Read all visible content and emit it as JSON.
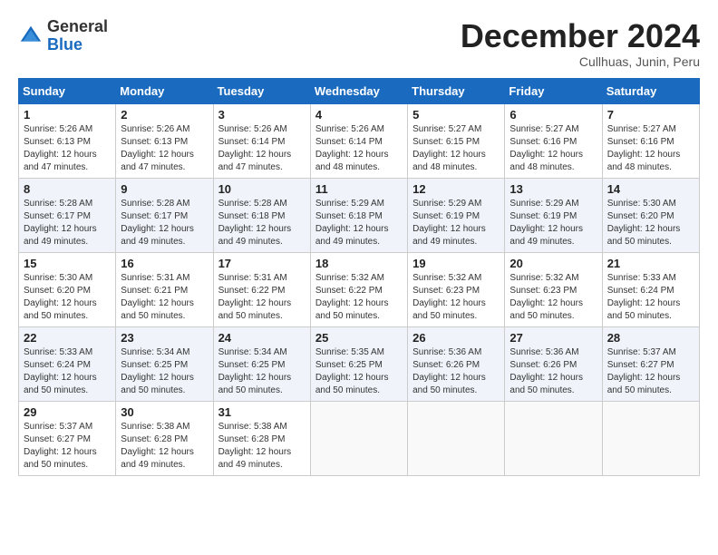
{
  "header": {
    "logo_line1": "General",
    "logo_line2": "Blue",
    "month_title": "December 2024",
    "subtitle": "Cullhuas, Junin, Peru"
  },
  "weekdays": [
    "Sunday",
    "Monday",
    "Tuesday",
    "Wednesday",
    "Thursday",
    "Friday",
    "Saturday"
  ],
  "weeks": [
    [
      {
        "day": "1",
        "info": "Sunrise: 5:26 AM\nSunset: 6:13 PM\nDaylight: 12 hours\nand 47 minutes."
      },
      {
        "day": "2",
        "info": "Sunrise: 5:26 AM\nSunset: 6:13 PM\nDaylight: 12 hours\nand 47 minutes."
      },
      {
        "day": "3",
        "info": "Sunrise: 5:26 AM\nSunset: 6:14 PM\nDaylight: 12 hours\nand 47 minutes."
      },
      {
        "day": "4",
        "info": "Sunrise: 5:26 AM\nSunset: 6:14 PM\nDaylight: 12 hours\nand 48 minutes."
      },
      {
        "day": "5",
        "info": "Sunrise: 5:27 AM\nSunset: 6:15 PM\nDaylight: 12 hours\nand 48 minutes."
      },
      {
        "day": "6",
        "info": "Sunrise: 5:27 AM\nSunset: 6:16 PM\nDaylight: 12 hours\nand 48 minutes."
      },
      {
        "day": "7",
        "info": "Sunrise: 5:27 AM\nSunset: 6:16 PM\nDaylight: 12 hours\nand 48 minutes."
      }
    ],
    [
      {
        "day": "8",
        "info": "Sunrise: 5:28 AM\nSunset: 6:17 PM\nDaylight: 12 hours\nand 49 minutes."
      },
      {
        "day": "9",
        "info": "Sunrise: 5:28 AM\nSunset: 6:17 PM\nDaylight: 12 hours\nand 49 minutes."
      },
      {
        "day": "10",
        "info": "Sunrise: 5:28 AM\nSunset: 6:18 PM\nDaylight: 12 hours\nand 49 minutes."
      },
      {
        "day": "11",
        "info": "Sunrise: 5:29 AM\nSunset: 6:18 PM\nDaylight: 12 hours\nand 49 minutes."
      },
      {
        "day": "12",
        "info": "Sunrise: 5:29 AM\nSunset: 6:19 PM\nDaylight: 12 hours\nand 49 minutes."
      },
      {
        "day": "13",
        "info": "Sunrise: 5:29 AM\nSunset: 6:19 PM\nDaylight: 12 hours\nand 49 minutes."
      },
      {
        "day": "14",
        "info": "Sunrise: 5:30 AM\nSunset: 6:20 PM\nDaylight: 12 hours\nand 50 minutes."
      }
    ],
    [
      {
        "day": "15",
        "info": "Sunrise: 5:30 AM\nSunset: 6:20 PM\nDaylight: 12 hours\nand 50 minutes."
      },
      {
        "day": "16",
        "info": "Sunrise: 5:31 AM\nSunset: 6:21 PM\nDaylight: 12 hours\nand 50 minutes."
      },
      {
        "day": "17",
        "info": "Sunrise: 5:31 AM\nSunset: 6:22 PM\nDaylight: 12 hours\nand 50 minutes."
      },
      {
        "day": "18",
        "info": "Sunrise: 5:32 AM\nSunset: 6:22 PM\nDaylight: 12 hours\nand 50 minutes."
      },
      {
        "day": "19",
        "info": "Sunrise: 5:32 AM\nSunset: 6:23 PM\nDaylight: 12 hours\nand 50 minutes."
      },
      {
        "day": "20",
        "info": "Sunrise: 5:32 AM\nSunset: 6:23 PM\nDaylight: 12 hours\nand 50 minutes."
      },
      {
        "day": "21",
        "info": "Sunrise: 5:33 AM\nSunset: 6:24 PM\nDaylight: 12 hours\nand 50 minutes."
      }
    ],
    [
      {
        "day": "22",
        "info": "Sunrise: 5:33 AM\nSunset: 6:24 PM\nDaylight: 12 hours\nand 50 minutes."
      },
      {
        "day": "23",
        "info": "Sunrise: 5:34 AM\nSunset: 6:25 PM\nDaylight: 12 hours\nand 50 minutes."
      },
      {
        "day": "24",
        "info": "Sunrise: 5:34 AM\nSunset: 6:25 PM\nDaylight: 12 hours\nand 50 minutes."
      },
      {
        "day": "25",
        "info": "Sunrise: 5:35 AM\nSunset: 6:25 PM\nDaylight: 12 hours\nand 50 minutes."
      },
      {
        "day": "26",
        "info": "Sunrise: 5:36 AM\nSunset: 6:26 PM\nDaylight: 12 hours\nand 50 minutes."
      },
      {
        "day": "27",
        "info": "Sunrise: 5:36 AM\nSunset: 6:26 PM\nDaylight: 12 hours\nand 50 minutes."
      },
      {
        "day": "28",
        "info": "Sunrise: 5:37 AM\nSunset: 6:27 PM\nDaylight: 12 hours\nand 50 minutes."
      }
    ],
    [
      {
        "day": "29",
        "info": "Sunrise: 5:37 AM\nSunset: 6:27 PM\nDaylight: 12 hours\nand 50 minutes."
      },
      {
        "day": "30",
        "info": "Sunrise: 5:38 AM\nSunset: 6:28 PM\nDaylight: 12 hours\nand 49 minutes."
      },
      {
        "day": "31",
        "info": "Sunrise: 5:38 AM\nSunset: 6:28 PM\nDaylight: 12 hours\nand 49 minutes."
      },
      null,
      null,
      null,
      null
    ]
  ]
}
